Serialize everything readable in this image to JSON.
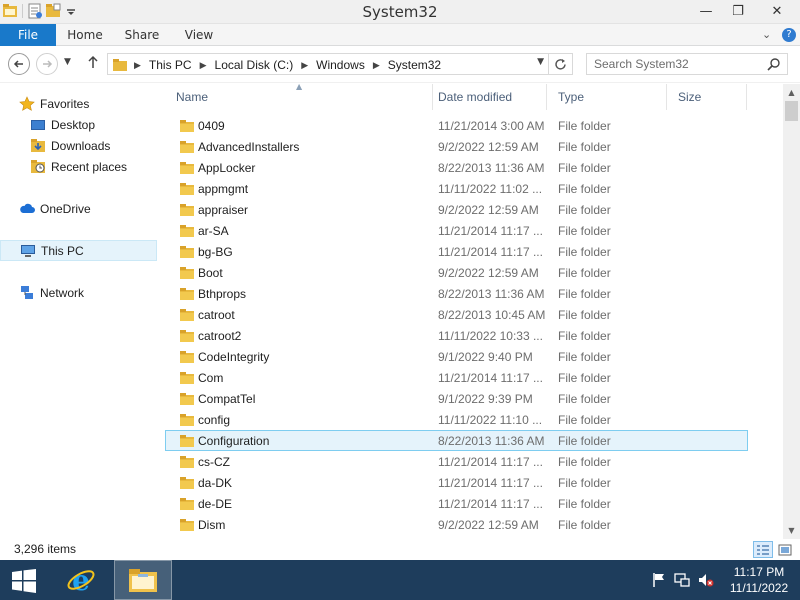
{
  "window": {
    "title": "System32",
    "controls": {
      "minimize": "—",
      "maximize": "❐",
      "close": "✕"
    }
  },
  "ribbon": {
    "tabs": [
      "File",
      "Home",
      "Share",
      "View"
    ],
    "collapse_glyph": "⌄",
    "help_glyph": "?"
  },
  "address": {
    "crumbs": [
      "This PC",
      "Local Disk (C:)",
      "Windows",
      "System32"
    ],
    "search_placeholder": "Search System32"
  },
  "nav": {
    "favorites_label": "Favorites",
    "favorites": [
      "Desktop",
      "Downloads",
      "Recent places"
    ],
    "onedrive": "OneDrive",
    "thispc": "This PC",
    "network": "Network"
  },
  "columns": {
    "name": "Name",
    "date": "Date modified",
    "type": "Type",
    "size": "Size"
  },
  "files": [
    {
      "name": "0409",
      "date": "11/21/2014 3:00 AM",
      "type": "File folder"
    },
    {
      "name": "AdvancedInstallers",
      "date": "9/2/2022 12:59 AM",
      "type": "File folder"
    },
    {
      "name": "AppLocker",
      "date": "8/22/2013 11:36 AM",
      "type": "File folder"
    },
    {
      "name": "appmgmt",
      "date": "11/11/2022 11:02 ...",
      "type": "File folder"
    },
    {
      "name": "appraiser",
      "date": "9/2/2022 12:59 AM",
      "type": "File folder"
    },
    {
      "name": "ar-SA",
      "date": "11/21/2014 11:17 ...",
      "type": "File folder"
    },
    {
      "name": "bg-BG",
      "date": "11/21/2014 11:17 ...",
      "type": "File folder"
    },
    {
      "name": "Boot",
      "date": "9/2/2022 12:59 AM",
      "type": "File folder"
    },
    {
      "name": "Bthprops",
      "date": "8/22/2013 11:36 AM",
      "type": "File folder"
    },
    {
      "name": "catroot",
      "date": "8/22/2013 10:45 AM",
      "type": "File folder"
    },
    {
      "name": "catroot2",
      "date": "11/11/2022 10:33 ...",
      "type": "File folder"
    },
    {
      "name": "CodeIntegrity",
      "date": "9/1/2022 9:40 PM",
      "type": "File folder"
    },
    {
      "name": "Com",
      "date": "11/21/2014 11:17 ...",
      "type": "File folder"
    },
    {
      "name": "CompatTel",
      "date": "9/1/2022 9:39 PM",
      "type": "File folder"
    },
    {
      "name": "config",
      "date": "11/11/2022 11:10 ...",
      "type": "File folder"
    },
    {
      "name": "Configuration",
      "date": "8/22/2013 11:36 AM",
      "type": "File folder",
      "selected": true
    },
    {
      "name": "cs-CZ",
      "date": "11/21/2014 11:17 ...",
      "type": "File folder"
    },
    {
      "name": "da-DK",
      "date": "11/21/2014 11:17 ...",
      "type": "File folder"
    },
    {
      "name": "de-DE",
      "date": "11/21/2014 11:17 ...",
      "type": "File folder"
    },
    {
      "name": "Dism",
      "date": "9/2/2022 12:59 AM",
      "type": "File folder"
    }
  ],
  "status": {
    "item_count": "3,296 items"
  },
  "taskbar": {
    "time": "11:17 PM",
    "date": "11/11/2022",
    "apps": [
      "internet-explorer",
      "file-explorer"
    ]
  },
  "colors": {
    "file_tab": "#1979ca",
    "selection_bg": "#e5f3fb",
    "selection_border": "#7ecdf0",
    "folder_yellow": "#e8b93e",
    "taskbar": "#1e3d5c"
  }
}
